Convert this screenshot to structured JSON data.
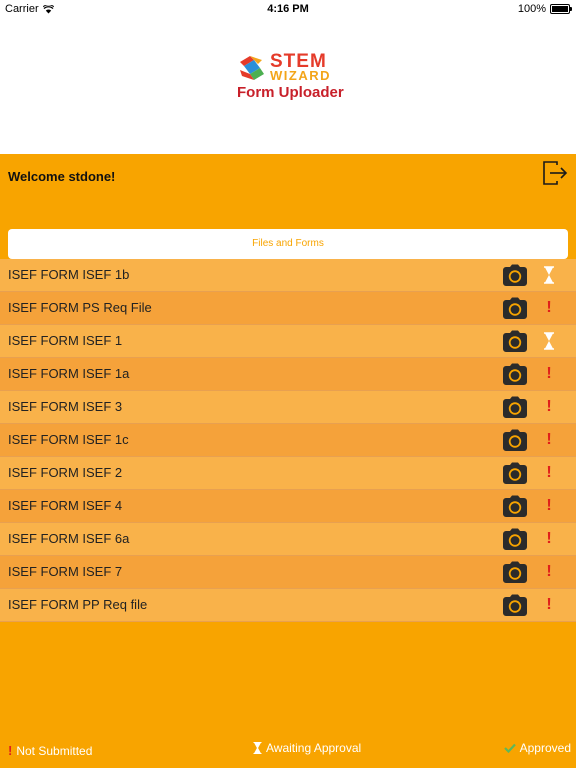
{
  "status_bar": {
    "carrier": "Carrier",
    "time": "4:16 PM",
    "battery": "100%"
  },
  "logo": {
    "line1": "STEM",
    "line2": "WIZARD",
    "line3": "Form Uploader"
  },
  "header": {
    "welcome": "Welcome stdone!",
    "logout_icon": "logout-icon"
  },
  "tab": {
    "label": "Files and Forms"
  },
  "forms": [
    {
      "name": "ISEF FORM ISEF 1b",
      "status": "awaiting"
    },
    {
      "name": "ISEF FORM PS Req File",
      "status": "not_submitted"
    },
    {
      "name": "ISEF FORM ISEF 1",
      "status": "awaiting"
    },
    {
      "name": "ISEF FORM ISEF 1a",
      "status": "not_submitted"
    },
    {
      "name": "ISEF FORM ISEF 3",
      "status": "not_submitted"
    },
    {
      "name": "ISEF FORM ISEF 1c",
      "status": "not_submitted"
    },
    {
      "name": "ISEF FORM ISEF 2",
      "status": "not_submitted"
    },
    {
      "name": "ISEF FORM ISEF 4",
      "status": "not_submitted"
    },
    {
      "name": "ISEF FORM ISEF 6a",
      "status": "not_submitted"
    },
    {
      "name": "ISEF FORM ISEF 7",
      "status": "not_submitted"
    },
    {
      "name": "ISEF FORM PP Req file",
      "status": "not_submitted"
    }
  ],
  "legend": {
    "not_submitted": "Not Submitted",
    "awaiting": "Awaiting Approval",
    "approved": "Approved"
  },
  "colors": {
    "background": "#f8a400",
    "row_light": "#f9b24a",
    "row_dark": "#f5a23a",
    "alert_red": "#e0201a",
    "approved_green": "#5cb85c"
  }
}
